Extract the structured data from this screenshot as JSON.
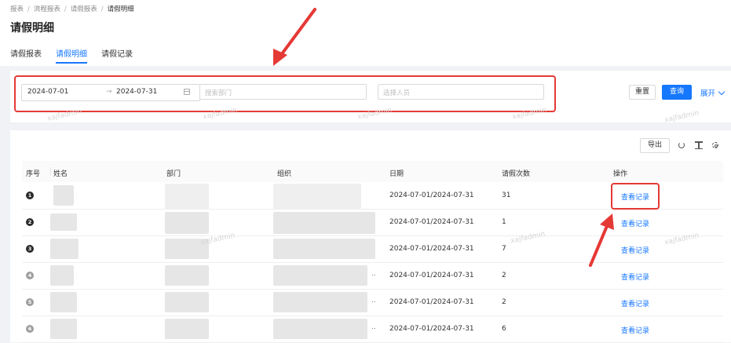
{
  "breadcrumb": [
    "报表",
    "流程报表",
    "请假报表",
    "请假明细"
  ],
  "page_title": "请假明细",
  "tabs": [
    {
      "label": "请假报表",
      "active": false
    },
    {
      "label": "请假明细",
      "active": true
    },
    {
      "label": "请假记录",
      "active": false
    }
  ],
  "filters": {
    "date_start": "2024-07-01",
    "date_end": "2024-07-31",
    "dept_placeholder": "搜索部门",
    "person_placeholder": "选择人员",
    "reset_label": "重置",
    "query_label": "查询",
    "expand_label": "展开"
  },
  "toolbar": {
    "export_label": "导出"
  },
  "table": {
    "columns": [
      "序号",
      "姓名",
      "部门",
      "组织",
      "日期",
      "请假次数",
      "操作"
    ],
    "rows": [
      {
        "no": "1",
        "date": "2024-07-01/2024-07-31",
        "count": "31",
        "action": "查看记录"
      },
      {
        "no": "2",
        "date": "2024-07-01/2024-07-31",
        "count": "1",
        "action": "查看记录"
      },
      {
        "no": "3",
        "date": "2024-07-01/2024-07-31",
        "count": "7",
        "action": "查看记录"
      },
      {
        "no": "4",
        "date": "2024-07-01/2024-07-31",
        "count": "2",
        "action": "查看记录"
      },
      {
        "no": "5",
        "date": "2024-07-01/2024-07-31",
        "count": "2",
        "action": "查看记录"
      },
      {
        "no": "6",
        "date": "2024-07-01/2024-07-31",
        "count": "6",
        "action": "查看记录"
      }
    ]
  },
  "watermark": "xajfadmin",
  "colors": {
    "accent": "#1677ff",
    "highlight": "#e53935"
  }
}
